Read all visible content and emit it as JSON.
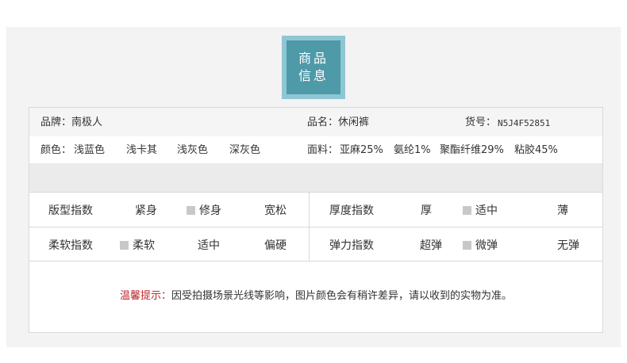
{
  "badge": {
    "line1": "商品",
    "line2": "信息"
  },
  "info": {
    "brand": "品牌：南极人",
    "name": "品名：休闲裤",
    "item_no_label": "货号：",
    "item_no_value": "N5J4F52851",
    "color_label": "颜色：",
    "colors": [
      "浅蓝色",
      "浅卡其",
      "浅灰色",
      "深灰色"
    ],
    "fabric_label": "面料：",
    "fabric": [
      "亚麻25%",
      "氨纶1%",
      "聚酯纤维29%",
      "粘胶45%"
    ]
  },
  "indices": {
    "fit": {
      "label": "版型指数",
      "options": [
        "紧身",
        "修身",
        "宽松"
      ],
      "selected": "修身"
    },
    "thickness": {
      "label": "厚度指数",
      "options": [
        "厚",
        "适中",
        "薄"
      ],
      "selected": "适中"
    },
    "softness": {
      "label": "柔软指数",
      "options": [
        "柔软",
        "适中",
        "偏硬"
      ],
      "selected": "柔软"
    },
    "elasticity": {
      "label": "弹力指数",
      "options": [
        "超弹",
        "微弹",
        "无弹"
      ],
      "selected": "微弹"
    }
  },
  "notice": {
    "label": "温馨提示：",
    "text": "因受拍摄场景光线等影响，图片颜色会有稍许差异，请以收到的实物为准。"
  }
}
